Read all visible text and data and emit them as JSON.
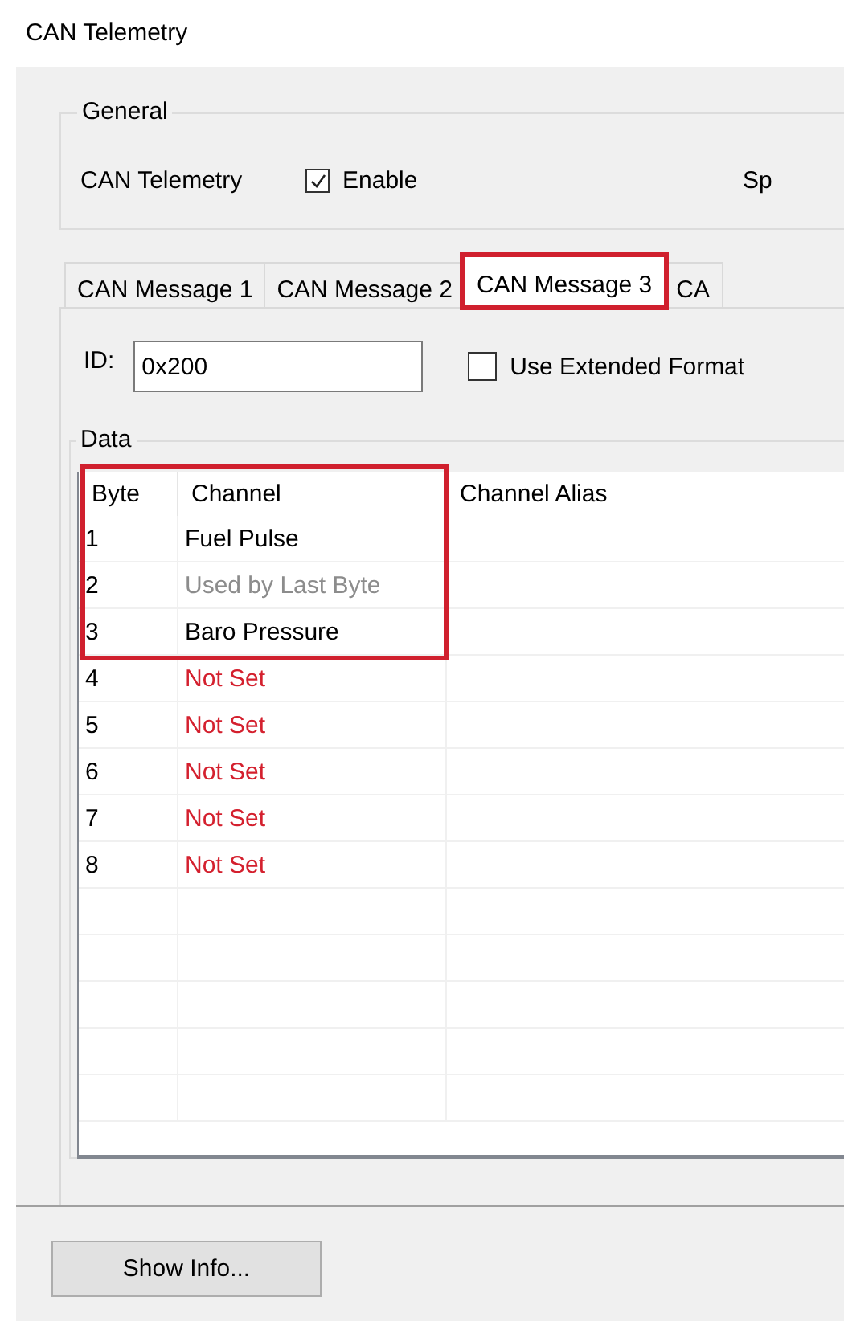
{
  "window": {
    "title": "CAN Telemetry"
  },
  "general": {
    "legend": "General",
    "label": "CAN Telemetry",
    "enable": {
      "label": "Enable",
      "checked": true
    },
    "cut_label": "Sp"
  },
  "tabs": [
    {
      "label": "CAN Message 1",
      "selected": false,
      "highlighted": false
    },
    {
      "label": "CAN Message 2",
      "selected": false,
      "highlighted": false
    },
    {
      "label": "CAN Message 3",
      "selected": true,
      "highlighted": true
    },
    {
      "label": "CA",
      "selected": false,
      "highlighted": false
    }
  ],
  "id_field": {
    "label": "ID:",
    "value": "0x200"
  },
  "extended_format": {
    "label": "Use Extended Format",
    "checked": false
  },
  "data": {
    "legend": "Data",
    "columns": [
      "Byte",
      "Channel",
      "Channel Alias"
    ],
    "header_highlighted": true,
    "rows": [
      {
        "byte": "1",
        "channel": "Fuel Pulse",
        "kind": "set",
        "highlighted": true
      },
      {
        "byte": "2",
        "channel": "Used by Last Byte",
        "kind": "used",
        "highlighted": true
      },
      {
        "byte": "3",
        "channel": "Baro Pressure",
        "kind": "set",
        "highlighted": true
      },
      {
        "byte": "4",
        "channel": "Not Set",
        "kind": "not_set",
        "highlighted": false
      },
      {
        "byte": "5",
        "channel": "Not Set",
        "kind": "not_set",
        "highlighted": false
      },
      {
        "byte": "6",
        "channel": "Not Set",
        "kind": "not_set",
        "highlighted": false
      },
      {
        "byte": "7",
        "channel": "Not Set",
        "kind": "not_set",
        "highlighted": false
      },
      {
        "byte": "8",
        "channel": "Not Set",
        "kind": "not_set",
        "highlighted": false
      }
    ]
  },
  "buttons": [
    "Show Info..."
  ]
}
